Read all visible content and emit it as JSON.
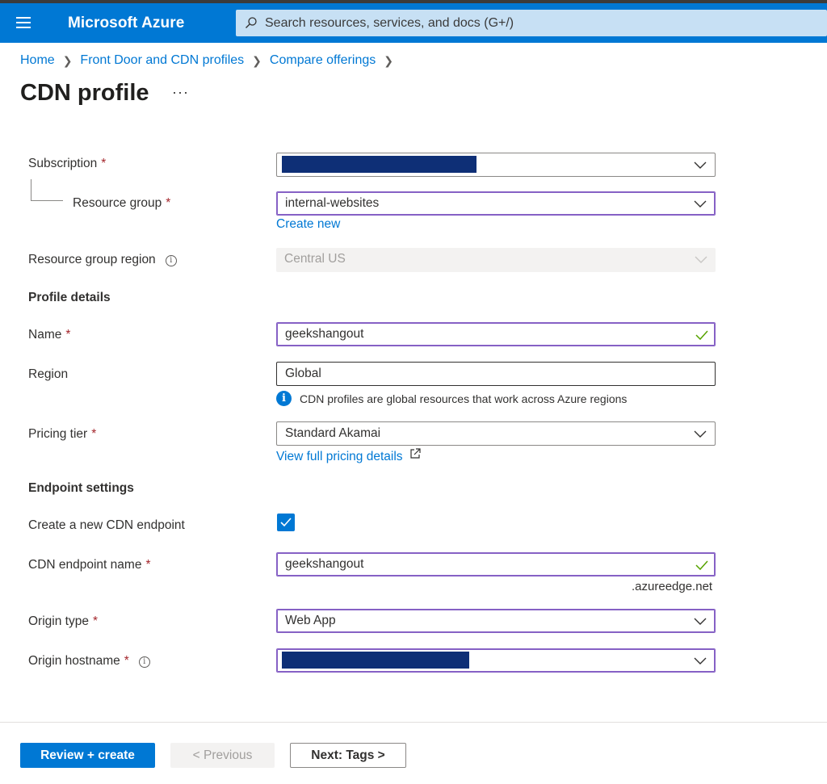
{
  "topbar": {
    "brand": "Microsoft Azure",
    "search_placeholder": "Search resources, services, and docs (G+/)"
  },
  "breadcrumb": [
    "Home",
    "Front Door and CDN profiles",
    "Compare offerings"
  ],
  "page": {
    "title": "CDN profile",
    "more": "···"
  },
  "form": {
    "subscription": {
      "label": "Subscription",
      "required": "*"
    },
    "resource_group": {
      "label": "Resource group",
      "required": "*",
      "value": "internal-websites",
      "create_new": "Create new"
    },
    "resource_group_region": {
      "label": "Resource group region",
      "value": "Central US"
    },
    "profile_details": "Profile details",
    "name": {
      "label": "Name",
      "required": "*",
      "value": "geekshangout"
    },
    "region": {
      "label": "Region",
      "value": "Global",
      "note": "CDN profiles are global resources that work across Azure regions"
    },
    "pricing_tier": {
      "label": "Pricing tier",
      "required": "*",
      "value": "Standard Akamai",
      "link": "View full pricing details"
    },
    "endpoint_settings": "Endpoint settings",
    "create_endpoint": {
      "label": "Create a new CDN endpoint",
      "checked": true
    },
    "endpoint_name": {
      "label": "CDN endpoint name",
      "required": "*",
      "value": "geekshangout",
      "suffix": ".azureedge.net"
    },
    "origin_type": {
      "label": "Origin type",
      "required": "*",
      "value": "Web App"
    },
    "origin_hostname": {
      "label": "Origin hostname",
      "required": "*"
    }
  },
  "footer": {
    "review_create": "Review + create",
    "previous": "< Previous",
    "next": "Next: Tags >"
  },
  "colors": {
    "accent": "#0078d4",
    "focus": "#8661c5",
    "required": "#a4262c",
    "valid": "#57a300"
  }
}
